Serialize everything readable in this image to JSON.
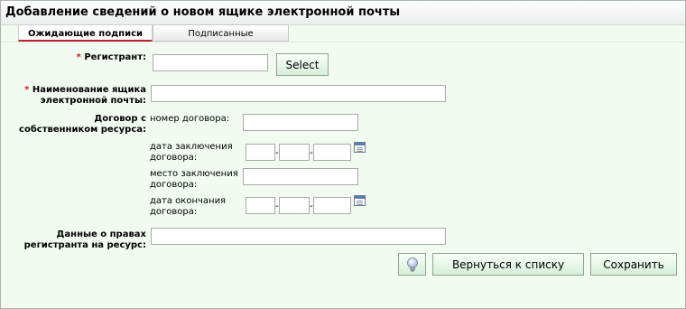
{
  "title": "Добавление сведений о новом ящике электронной почты",
  "tabs": {
    "pending": "Ожидающие подписи",
    "signed": "Подписанные"
  },
  "form": {
    "required_mark": "*",
    "registrant": {
      "label": "Регистрант:",
      "value": "",
      "select_label": "Select"
    },
    "mailbox": {
      "label_line1": "Наименование ящика",
      "label_line2": "электронной почты:",
      "value": ""
    },
    "contract": {
      "label_line1": "Договор с",
      "label_line2": "собственником ресурса:",
      "number_label": "номер договора:",
      "number_value": "",
      "conclusion_date_label_line1": "дата заключения",
      "conclusion_date_label_line2": "договора:",
      "place_label_line1": "место заключения",
      "place_label_line2": "договора:",
      "place_value": "",
      "end_date_label_line1": "дата окончания",
      "end_date_label_line2": "договора:",
      "date_separator": "-"
    },
    "rights": {
      "label_line1": "Данные о правах",
      "label_line2": "регистранта на ресурс:",
      "value": ""
    }
  },
  "buttons": {
    "back": "Вернуться к списку",
    "save": "Сохранить"
  },
  "icons": {
    "hint": "lightbulb-icon",
    "calendar": "calendar-icon"
  },
  "colors": {
    "panel_background": "#f1fbf0",
    "required_mark": "#d01818",
    "active_tab_underline": "#c0202c",
    "button_gradient_bottom": "#d5efd8"
  }
}
